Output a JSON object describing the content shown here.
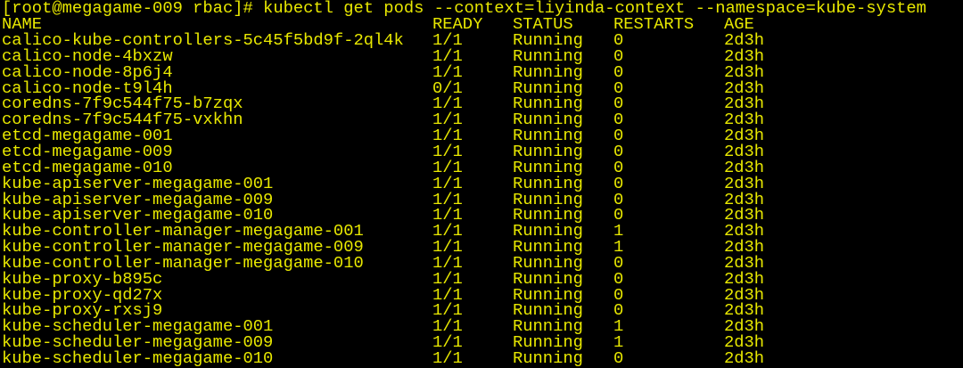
{
  "terminal": {
    "prompt": "[root@megagame-009 rbac]# ",
    "command": "kubectl get pods --context=liyinda-context --namespace=kube-system",
    "headers": [
      "NAME",
      "READY",
      "STATUS",
      "RESTARTS",
      "AGE"
    ],
    "rows": [
      [
        "calico-kube-controllers-5c45f5bd9f-2ql4k",
        "1/1",
        "Running",
        "0",
        "2d3h"
      ],
      [
        "calico-node-4bxzw",
        "1/1",
        "Running",
        "0",
        "2d3h"
      ],
      [
        "calico-node-8p6j4",
        "1/1",
        "Running",
        "0",
        "2d3h"
      ],
      [
        "calico-node-t9l4h",
        "0/1",
        "Running",
        "0",
        "2d3h"
      ],
      [
        "coredns-7f9c544f75-b7zqx",
        "1/1",
        "Running",
        "0",
        "2d3h"
      ],
      [
        "coredns-7f9c544f75-vxkhn",
        "1/1",
        "Running",
        "0",
        "2d3h"
      ],
      [
        "etcd-megagame-001",
        "1/1",
        "Running",
        "0",
        "2d3h"
      ],
      [
        "etcd-megagame-009",
        "1/1",
        "Running",
        "0",
        "2d3h"
      ],
      [
        "etcd-megagame-010",
        "1/1",
        "Running",
        "0",
        "2d3h"
      ],
      [
        "kube-apiserver-megagame-001",
        "1/1",
        "Running",
        "0",
        "2d3h"
      ],
      [
        "kube-apiserver-megagame-009",
        "1/1",
        "Running",
        "0",
        "2d3h"
      ],
      [
        "kube-apiserver-megagame-010",
        "1/1",
        "Running",
        "0",
        "2d3h"
      ],
      [
        "kube-controller-manager-megagame-001",
        "1/1",
        "Running",
        "1",
        "2d3h"
      ],
      [
        "kube-controller-manager-megagame-009",
        "1/1",
        "Running",
        "1",
        "2d3h"
      ],
      [
        "kube-controller-manager-megagame-010",
        "1/1",
        "Running",
        "0",
        "2d3h"
      ],
      [
        "kube-proxy-b895c",
        "1/1",
        "Running",
        "0",
        "2d3h"
      ],
      [
        "kube-proxy-qd27x",
        "1/1",
        "Running",
        "0",
        "2d3h"
      ],
      [
        "kube-proxy-rxsj9",
        "1/1",
        "Running",
        "0",
        "2d3h"
      ],
      [
        "kube-scheduler-megagame-001",
        "1/1",
        "Running",
        "1",
        "2d3h"
      ],
      [
        "kube-scheduler-megagame-009",
        "1/1",
        "Running",
        "1",
        "2d3h"
      ],
      [
        "kube-scheduler-megagame-010",
        "1/1",
        "Running",
        "0",
        "2d3h"
      ]
    ]
  }
}
